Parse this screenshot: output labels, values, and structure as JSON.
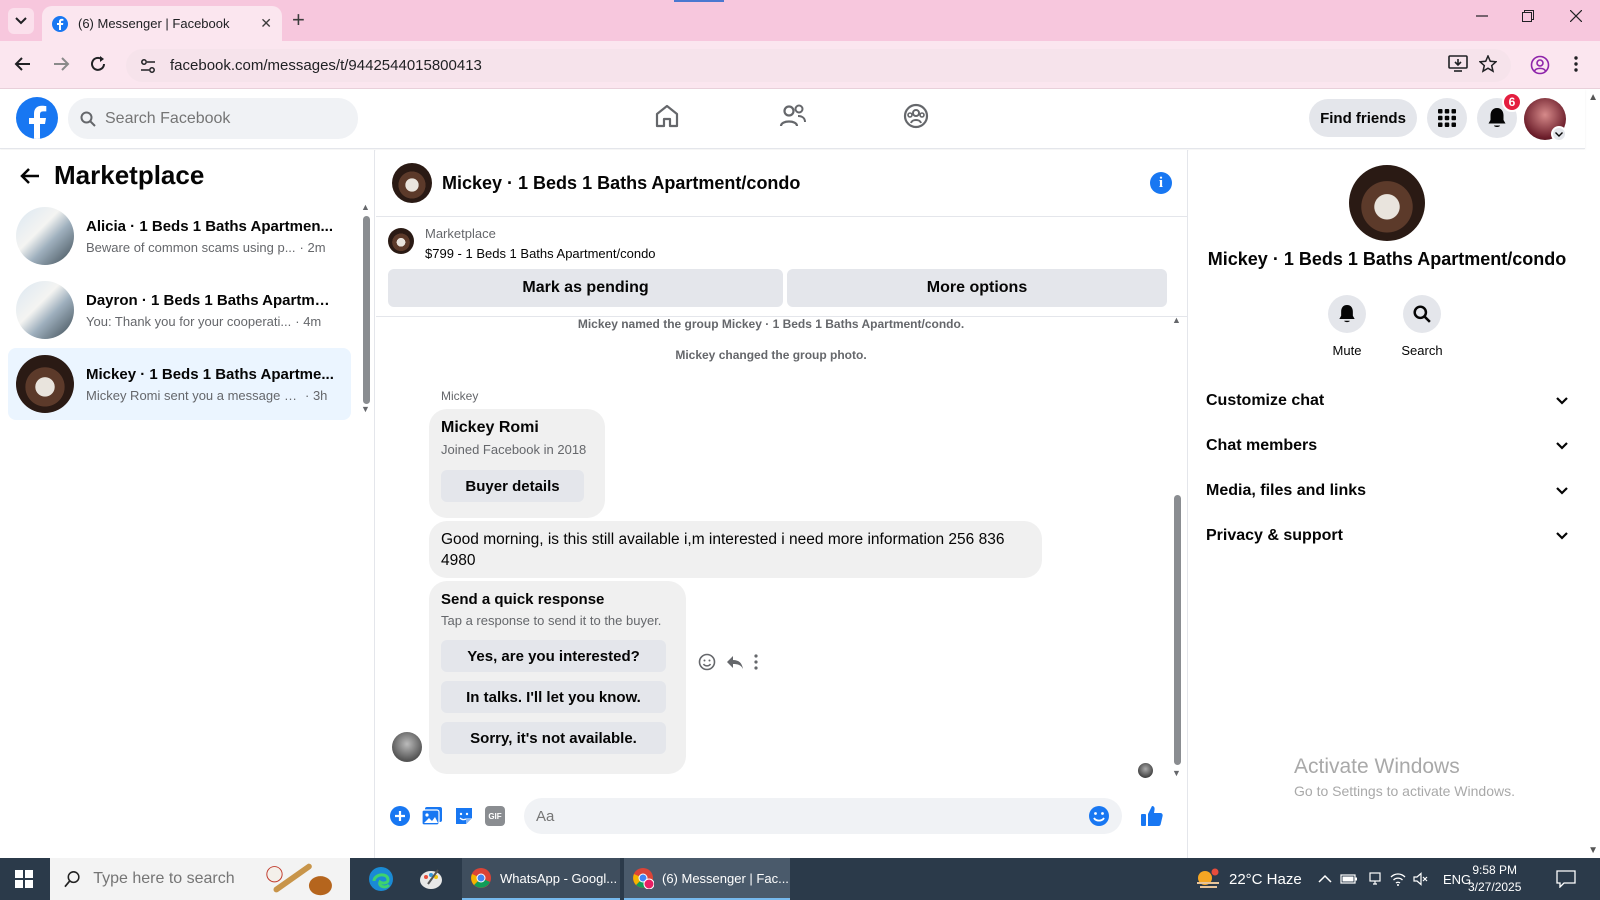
{
  "browser": {
    "tab_title": "(6) Messenger | Facebook",
    "url": "facebook.com/messages/t/9442544015800413"
  },
  "header": {
    "search_placeholder": "Search Facebook",
    "find_friends": "Find friends",
    "notification_count": "6"
  },
  "left": {
    "title": "Marketplace",
    "chats": [
      {
        "name": "Alicia · 1 Beds 1 Baths Apartmen...",
        "preview": "Beware of common scams using p...",
        "time": "· 2m"
      },
      {
        "name": "Dayron · 1 Beds 1 Baths Apartme...",
        "preview": "You: Thank you for your cooperati...",
        "time": "· 4m"
      },
      {
        "name": "Mickey · 1 Beds 1 Baths Apartme...",
        "preview": "Mickey Romi sent you a message a...",
        "time": "· 3h"
      }
    ]
  },
  "chat": {
    "title": "Mickey · 1 Beds 1 Baths Apartment/condo",
    "listing_category": "Marketplace",
    "listing_price": "$799 - 1 Beds 1 Baths Apartment/condo",
    "mark_pending": "Mark as pending",
    "more_options": "More options",
    "system_messages": [
      "Mickey named the group Mickey · 1 Beds 1 Baths Apartment/condo.",
      "Mickey changed the group photo."
    ],
    "sender_label": "Mickey",
    "profile_card": {
      "name": "Mickey Romi",
      "joined": "Joined Facebook in 2018",
      "button": "Buyer details"
    },
    "message": "Good morning, is this still available i,m interested i need more information 256 836 4980",
    "quick_response": {
      "title": "Send a quick response",
      "subtitle": "Tap a response to send it to the buyer.",
      "options": [
        "Yes, are you interested?",
        "In talks. I'll let you know.",
        "Sorry, it's not available."
      ]
    },
    "composer_placeholder": "Aa"
  },
  "right": {
    "name": "Mickey · 1 Beds 1 Baths Apartment/condo",
    "mute": "Mute",
    "search": "Search",
    "sections": [
      "Customize chat",
      "Chat members",
      "Media, files and links",
      "Privacy & support"
    ]
  },
  "watermark": {
    "line1": "Activate Windows",
    "line2": "Go to Settings to activate Windows."
  },
  "taskbar": {
    "search_placeholder": "Type here to search",
    "apps": [
      "WhatsApp - Googl...",
      "(6) Messenger | Fac..."
    ],
    "weather": "22°C  Haze",
    "lang": "ENG",
    "time": "9:58 PM",
    "date": "3/27/2025"
  }
}
